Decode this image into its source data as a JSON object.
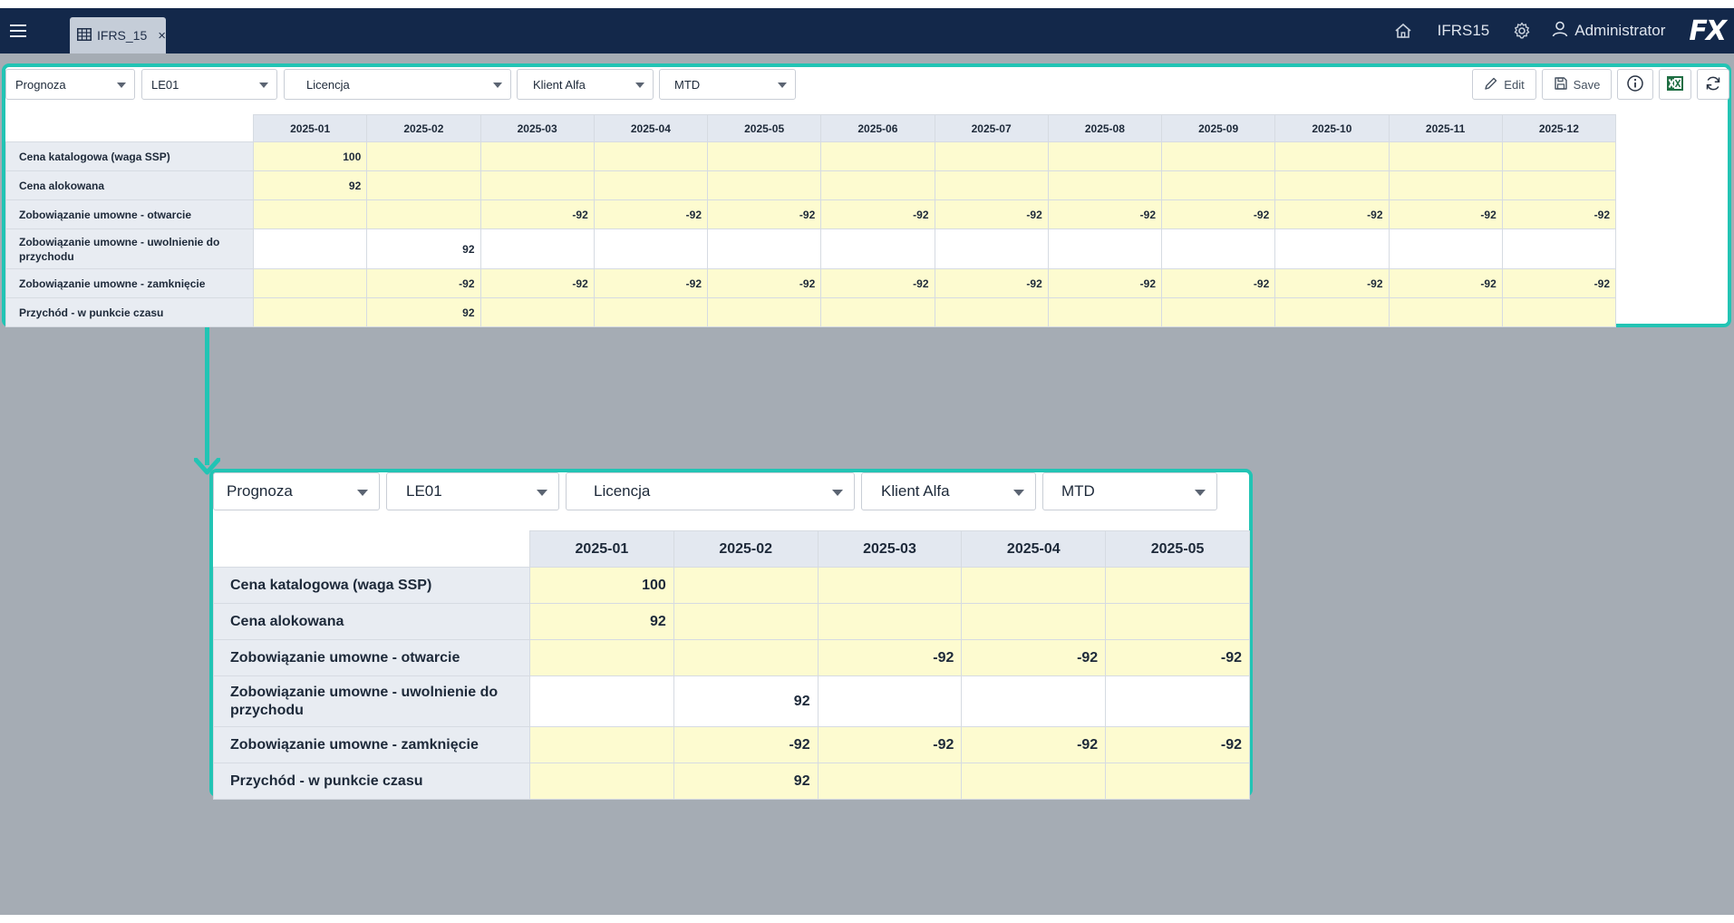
{
  "topbar": {
    "tab_label": "IFRS_15",
    "tab_close": "×",
    "app_name": "IFRS15",
    "user_name": "Administrator",
    "logo_text": "FX"
  },
  "filters": {
    "scenario": "Prognoza",
    "entity": "LE01",
    "product": "Licencja",
    "customer": "Klient Alfa",
    "period_view": "MTD"
  },
  "toolbar": {
    "edit_label": "Edit",
    "save_label": "Save"
  },
  "grid": {
    "columns": [
      "2025-01",
      "2025-02",
      "2025-03",
      "2025-04",
      "2025-05",
      "2025-06",
      "2025-07",
      "2025-08",
      "2025-09",
      "2025-10",
      "2025-11",
      "2025-12"
    ],
    "rows": [
      {
        "label": "Cena katalogowa (waga SSP)",
        "cells": [
          "100",
          "",
          "",
          "",
          "",
          "",
          "",
          "",
          "",
          "",
          "",
          ""
        ]
      },
      {
        "label": "Cena alokowana",
        "cells": [
          "92",
          "",
          "",
          "",
          "",
          "",
          "",
          "",
          "",
          "",
          "",
          ""
        ]
      },
      {
        "label": "Zobowiązanie umowne - otwarcie",
        "cells": [
          "",
          "",
          "-92",
          "-92",
          "-92",
          "-92",
          "-92",
          "-92",
          "-92",
          "-92",
          "-92",
          "-92"
        ]
      },
      {
        "label": "Zobowiązanie umowne - uwolnienie do przychodu",
        "cells": [
          "",
          "92",
          "",
          "",
          "",
          "",
          "",
          "",
          "",
          "",
          "",
          ""
        ]
      },
      {
        "label": "Zobowiązanie umowne - zamknięcie",
        "cells": [
          "",
          "-92",
          "-92",
          "-92",
          "-92",
          "-92",
          "-92",
          "-92",
          "-92",
          "-92",
          "-92",
          "-92"
        ]
      },
      {
        "label": "Przychód - w punkcie czasu",
        "cells": [
          "",
          "92",
          "",
          "",
          "",
          "",
          "",
          "",
          "",
          "",
          "",
          ""
        ]
      }
    ]
  },
  "colors": {
    "topbar": "#13284a",
    "accent_teal": "#22c4b4",
    "cell_yellow": "#fdfbd0",
    "header_gray": "#e3e8f0",
    "backdrop": "#a5acb4"
  }
}
